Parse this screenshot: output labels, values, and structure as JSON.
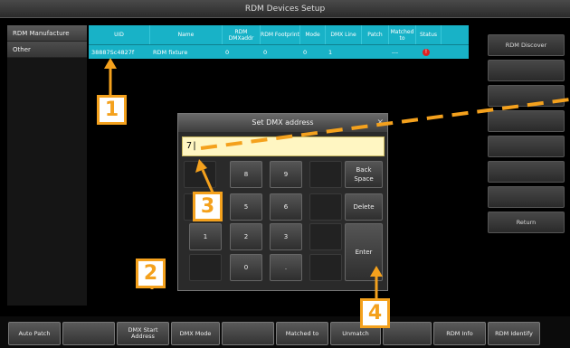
{
  "window": {
    "title": "RDM Devices Setup"
  },
  "left_panel": {
    "items": [
      "RDM Manufacture",
      "Other"
    ]
  },
  "table": {
    "headers": [
      "UID",
      "Name",
      "RDM DMXaddr",
      "RDM Footprint",
      "Mode",
      "DMX Line",
      "Patch",
      "Matched to",
      "Status"
    ],
    "rows": [
      {
        "uid": "38887Sc4827f",
        "name": "RDM fixture",
        "dmxaddr": "0",
        "footprint": "0",
        "mode": "0",
        "line": "1",
        "patch": "",
        "matched": "---",
        "status_glyph": "!"
      }
    ]
  },
  "right_panel": {
    "buttons": [
      "RDM Discover",
      "",
      "",
      "",
      "",
      "",
      "",
      "Return"
    ]
  },
  "dialog": {
    "title": "Set DMX address",
    "close_glyph": "✕",
    "input_value": "7|",
    "keys": {
      "k8": "8",
      "k9": "9",
      "backspace": "Back Space",
      "k5": "5",
      "k6": "6",
      "delete": "Delete",
      "k1": "1",
      "k2": "2",
      "k3": "3",
      "enter": "Enter",
      "k0": "0",
      "dot": "."
    }
  },
  "bottom_bar": {
    "buttons": [
      "Auto Patch",
      "",
      "DMX Start Address",
      "DMX Mode",
      "",
      "Matched to",
      "Unmatch",
      "",
      "RDM Info",
      "RDM Identify"
    ]
  },
  "callouts": [
    "1",
    "2",
    "3",
    "4"
  ],
  "colors": {
    "accent": "#18b2c7",
    "callout": "#f4a11d",
    "status": "#e02020",
    "input_bg": "#fff6c2"
  }
}
